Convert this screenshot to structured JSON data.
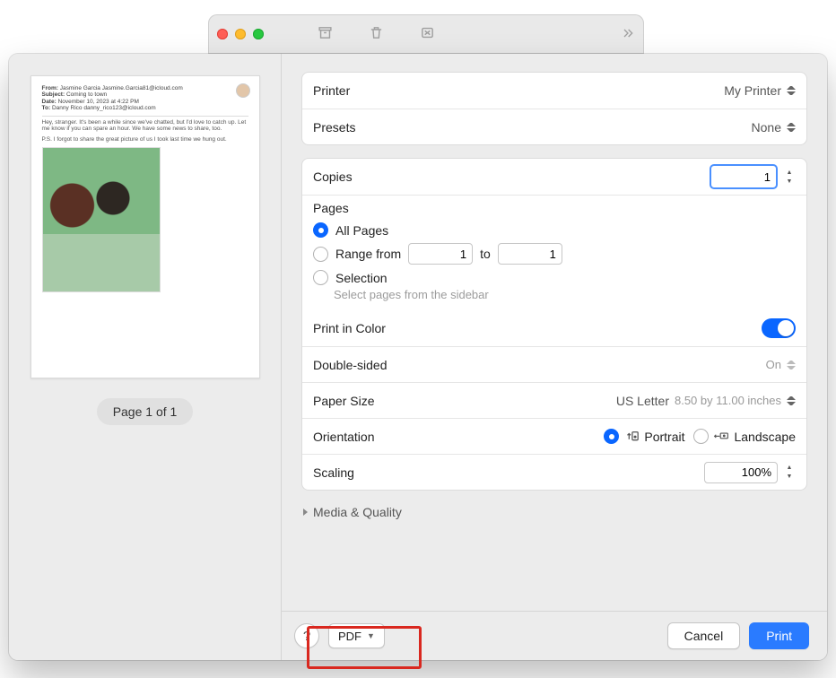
{
  "preview": {
    "pageIndicator": "Page 1 of 1",
    "email": {
      "fromLabel": "From:",
      "fromName": "Jasmine Garcia",
      "fromAddr": "Jasmine.Garcia81@icloud.com",
      "subjectLabel": "Subject:",
      "subject": "Coming to town",
      "dateLabel": "Date:",
      "date": "November 10, 2023 at 4:22 PM",
      "toLabel": "To:",
      "to": "Danny Rico danny_rico123@icloud.com",
      "body1": "Hey, stranger. It's been a while since we've chatted, but I'd love to catch up. Let me know if you can spare an hour. We have some news to share, too.",
      "body2": "P.S. I forgot to share the great picture of us I took last time we hung out."
    }
  },
  "printer": {
    "label": "Printer",
    "value": "My Printer"
  },
  "presets": {
    "label": "Presets",
    "value": "None"
  },
  "copies": {
    "label": "Copies",
    "value": "1"
  },
  "pages": {
    "label": "Pages",
    "allLabel": "All Pages",
    "rangeLabel": "Range from",
    "rangeFrom": "1",
    "rangeToLabel": "to",
    "rangeTo": "1",
    "selectionLabel": "Selection",
    "selectionHint": "Select pages from the sidebar"
  },
  "printInColor": {
    "label": "Print in Color"
  },
  "doubleSided": {
    "label": "Double-sided",
    "value": "On"
  },
  "paperSize": {
    "label": "Paper Size",
    "value": "US Letter",
    "dims": "8.50 by 11.00 inches"
  },
  "orientation": {
    "label": "Orientation",
    "portrait": "Portrait",
    "landscape": "Landscape"
  },
  "scaling": {
    "label": "Scaling",
    "value": "100%"
  },
  "mediaQuality": {
    "label": "Media & Quality"
  },
  "footer": {
    "pdf": "PDF",
    "cancel": "Cancel",
    "print": "Print",
    "help": "?"
  }
}
